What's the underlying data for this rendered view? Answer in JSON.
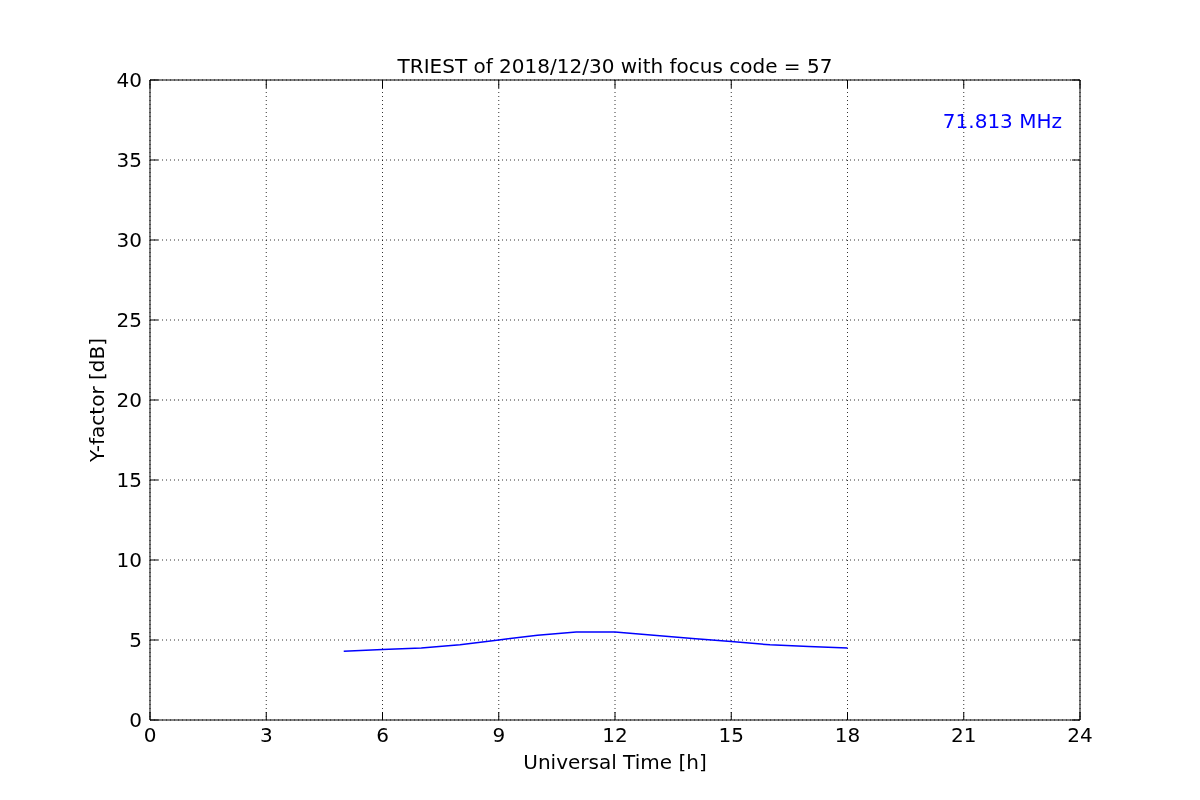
{
  "chart_data": {
    "type": "line",
    "title": "TRIEST of 2018/12/30 with focus code = 57",
    "xlabel": "Universal Time [h]",
    "ylabel": "Y-factor [dB]",
    "x": [
      5,
      6,
      7,
      8,
      9,
      10,
      11,
      12,
      13,
      14,
      15,
      16,
      17,
      18
    ],
    "series": [
      {
        "name": "71.813 MHz",
        "color": "#0000ff",
        "values": [
          4.3,
          4.4,
          4.5,
          4.7,
          5.0,
          5.3,
          5.5,
          5.5,
          5.3,
          5.1,
          4.9,
          4.7,
          4.6,
          4.5
        ]
      }
    ],
    "xlim": [
      0,
      24
    ],
    "ylim": [
      0,
      40
    ],
    "xticks": [
      0,
      3,
      6,
      9,
      12,
      15,
      18,
      21,
      24
    ],
    "yticks": [
      0,
      5,
      10,
      15,
      20,
      25,
      30,
      35,
      40
    ],
    "grid": true
  }
}
